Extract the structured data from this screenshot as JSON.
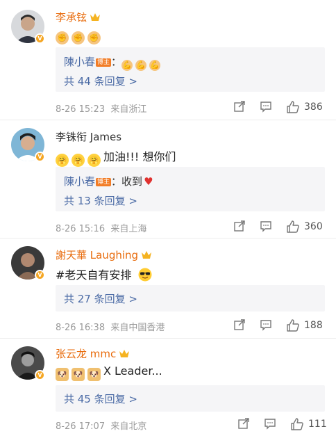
{
  "comments": [
    {
      "user": "李承铉",
      "text": "",
      "reply": {
        "user": "陳小春",
        "badge": "博主",
        "colon": "：",
        "text": ""
      },
      "more": "共 44 条回复 >",
      "time": "8-26 15:23",
      "location": "来自浙江",
      "likes": "386"
    },
    {
      "user": "李铢衔 James",
      "text": "加油!!! 想你们",
      "reply": {
        "user": "陳小春",
        "badge": "博主",
        "colon": "：",
        "text": "收到"
      },
      "more": "共 13 条回复 >",
      "time": "8-26 15:16",
      "location": "来自上海",
      "likes": "360"
    },
    {
      "user": "謝天華 Laughing",
      "text": "#老天自有安排",
      "more": "共 27 条回复 >",
      "time": "8-26 16:38",
      "location": "来自中国香港",
      "likes": "188"
    },
    {
      "user": "张云龙 mmc",
      "text": "X Leader...",
      "more": "共 45 条回复 >",
      "time": "8-26 17:07",
      "location": "来自北京",
      "likes": "111"
    }
  ],
  "colors": {
    "vip_name": "#e86b0c",
    "link": "#4a6aa5",
    "meta": "#999999",
    "reply_bg": "#f5f5f7"
  },
  "icons": [
    "crown-icon",
    "verified-badge-icon",
    "fist-emoji-icon",
    "flex-emoji-icon",
    "hug-emoji-icon",
    "heart-emoji-icon",
    "sunglasses-emoji-icon",
    "doge-emoji-icon",
    "share-icon",
    "comment-icon",
    "like-icon"
  ]
}
